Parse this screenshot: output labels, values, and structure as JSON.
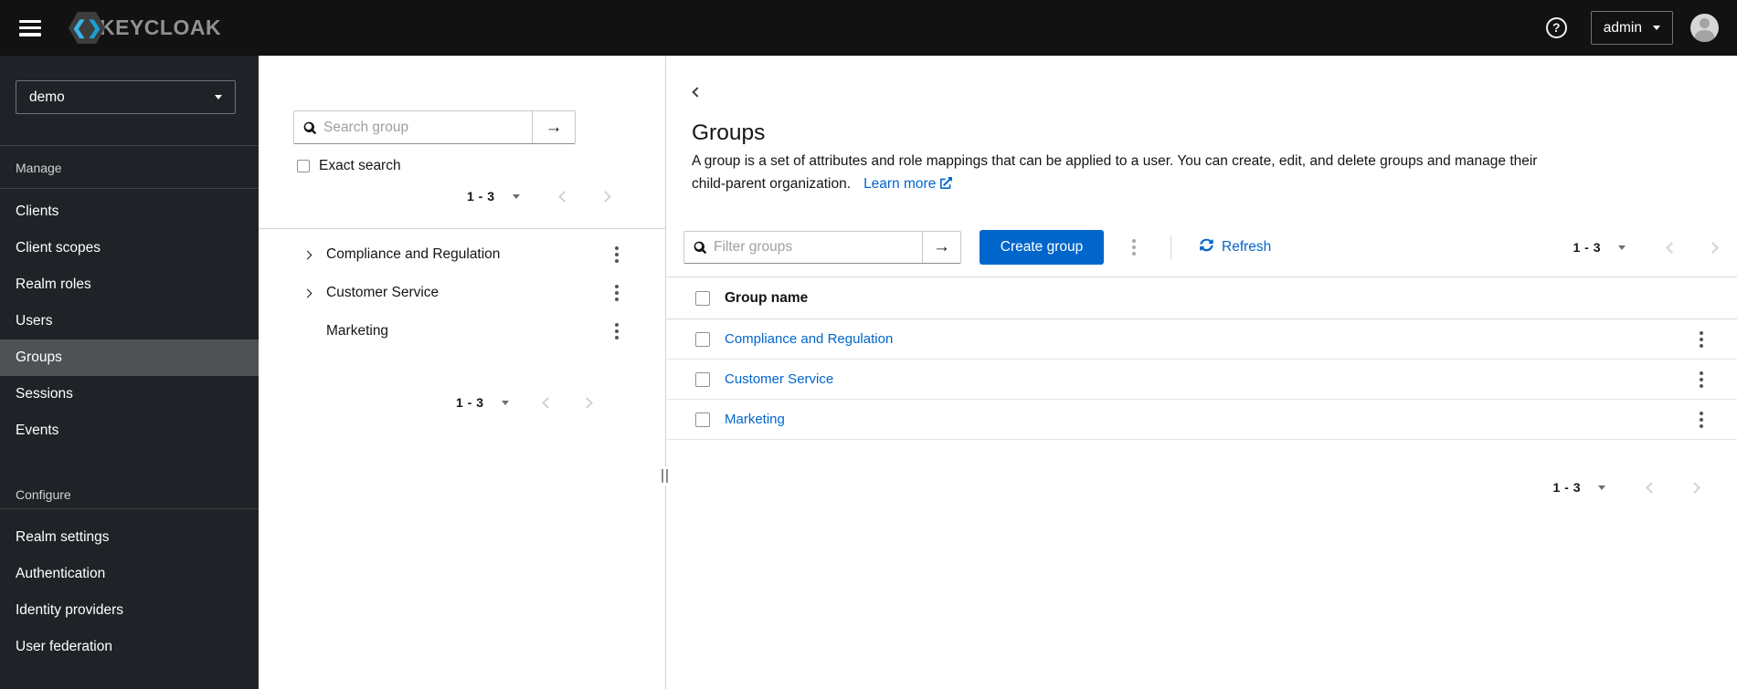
{
  "colors": {
    "accent": "#0066cc",
    "link": "#0066cc",
    "masthead_bg": "#121212",
    "sidebar_bg": "#1f2227",
    "sidebar_selected_bg": "#4f5255",
    "brand_blue": "#3cb4e6"
  },
  "icons": {
    "arrow_right": "→",
    "question_mark": "?",
    "brand_chevron_left": "❮",
    "brand_chevron_right": "❯"
  },
  "masthead": {
    "brand": "KEYCLOAK",
    "user_menu": {
      "label": "admin"
    }
  },
  "sidebar": {
    "realm_selector": {
      "value": "demo"
    },
    "sections": [
      {
        "label": "Manage",
        "items": [
          {
            "label": "Clients"
          },
          {
            "label": "Client scopes"
          },
          {
            "label": "Realm roles"
          },
          {
            "label": "Users"
          },
          {
            "label": "Groups",
            "selected": true
          },
          {
            "label": "Sessions"
          },
          {
            "label": "Events"
          }
        ]
      },
      {
        "label": "Configure",
        "items": [
          {
            "label": "Realm settings"
          },
          {
            "label": "Authentication"
          },
          {
            "label": "Identity providers"
          },
          {
            "label": "User federation"
          }
        ]
      }
    ]
  },
  "tree_panel": {
    "search_placeholder": "Search group",
    "exact_search_label": "Exact search",
    "pagination_top": {
      "range": "1 - 3"
    },
    "pagination_bottom": {
      "range": "1 - 3"
    },
    "items": [
      {
        "name": "Compliance and Regulation",
        "expandable": true
      },
      {
        "name": "Customer Service",
        "expandable": true
      },
      {
        "name": "Marketing",
        "expandable": false
      }
    ]
  },
  "main": {
    "title": "Groups",
    "description_line1": "A group is a set of attributes and role mappings that can be applied to a user. You can create, edit, and delete groups and manage their",
    "description_line2": "child-parent organization.",
    "learn_more_label": "Learn more",
    "toolbar": {
      "filter_placeholder": "Filter groups",
      "create_button_label": "Create group",
      "refresh_label": "Refresh",
      "pagination": {
        "range": "1 - 3"
      }
    },
    "table": {
      "header": "Group name",
      "rows": [
        {
          "name": "Compliance and Regulation"
        },
        {
          "name": "Customer Service"
        },
        {
          "name": "Marketing"
        }
      ]
    },
    "pagination_bottom": {
      "range": "1 - 3"
    }
  }
}
